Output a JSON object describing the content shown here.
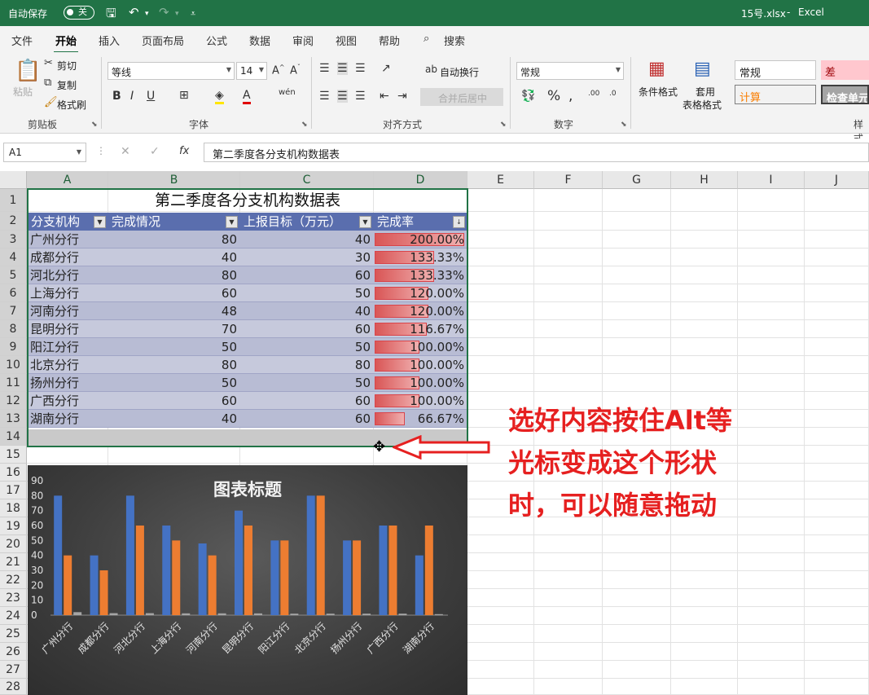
{
  "titlebar": {
    "autosave_label": "自动保存",
    "autosave_state": "关",
    "filename": "15号.xlsx",
    "separator": "-",
    "app": "Excel"
  },
  "ribbon_tabs": [
    "文件",
    "开始",
    "插入",
    "页面布局",
    "公式",
    "数据",
    "审阅",
    "视图",
    "帮助",
    "搜索"
  ],
  "ribbon": {
    "paste": "粘贴",
    "cut": "剪切",
    "copy": "复制",
    "format_painter": "格式刷",
    "clipboard_group": "剪贴板",
    "font_name": "等线",
    "font_size": "14",
    "font_group": "字体",
    "wrap_text": "自动换行",
    "merge_center": "合并后居中",
    "align_group": "对齐方式",
    "number_format": "常规",
    "number_group": "数字",
    "cond_format": "条件格式",
    "table_format_1": "套用",
    "table_format_2": "表格格式",
    "style_normal": "常规",
    "style_bad": "差",
    "style_calc": "计算",
    "style_check": "检查单元",
    "styles_group": "样式"
  },
  "formula_bar": {
    "name_box": "A1",
    "fx": "fx",
    "content": "第二季度各分支机构数据表"
  },
  "columns": [
    "A",
    "B",
    "C",
    "D",
    "E",
    "F",
    "G",
    "H",
    "I",
    "J"
  ],
  "rows": [
    "1",
    "2",
    "3",
    "4",
    "5",
    "6",
    "7",
    "8",
    "9",
    "10",
    "11",
    "12",
    "13",
    "14",
    "15",
    "16",
    "17",
    "18",
    "19",
    "20",
    "21",
    "22",
    "23",
    "24",
    "25",
    "26",
    "27",
    "28"
  ],
  "table": {
    "title": "第二季度各分支机构数据表",
    "headers": [
      "分支机构",
      "完成情况",
      "上报目标（万元）",
      "完成率"
    ],
    "rows": [
      {
        "name": "广州分行",
        "done": "80",
        "target": "40",
        "rate": "200.00%",
        "rate_value": 2.0
      },
      {
        "name": "成都分行",
        "done": "40",
        "target": "30",
        "rate": "133.33%",
        "rate_value": 1.3333
      },
      {
        "name": "河北分行",
        "done": "80",
        "target": "60",
        "rate": "133.33%",
        "rate_value": 1.3333
      },
      {
        "name": "上海分行",
        "done": "60",
        "target": "50",
        "rate": "120.00%",
        "rate_value": 1.2
      },
      {
        "name": "河南分行",
        "done": "48",
        "target": "40",
        "rate": "120.00%",
        "rate_value": 1.2
      },
      {
        "name": "昆明分行",
        "done": "70",
        "target": "60",
        "rate": "116.67%",
        "rate_value": 1.1667
      },
      {
        "name": "阳江分行",
        "done": "50",
        "target": "50",
        "rate": "100.00%",
        "rate_value": 1.0
      },
      {
        "name": "北京分行",
        "done": "80",
        "target": "80",
        "rate": "100.00%",
        "rate_value": 1.0
      },
      {
        "name": "扬州分行",
        "done": "50",
        "target": "50",
        "rate": "100.00%",
        "rate_value": 1.0
      },
      {
        "name": "广西分行",
        "done": "60",
        "target": "60",
        "rate": "100.00%",
        "rate_value": 1.0
      },
      {
        "name": "湖南分行",
        "done": "40",
        "target": "60",
        "rate": "66.67%",
        "rate_value": 0.6667
      }
    ]
  },
  "chart_data": {
    "type": "bar",
    "title": "图表标题",
    "categories": [
      "广州分行",
      "成都分行",
      "河北分行",
      "上海分行",
      "河南分行",
      "昆明分行",
      "阳江分行",
      "北京分行",
      "扬州分行",
      "广西分行",
      "湖南分行"
    ],
    "series": [
      {
        "values": [
          80,
          40,
          80,
          60,
          48,
          70,
          50,
          80,
          50,
          60,
          40
        ],
        "color": "#4472c4"
      },
      {
        "values": [
          40,
          30,
          60,
          50,
          40,
          60,
          50,
          80,
          50,
          60,
          60
        ],
        "color": "#ed7d31"
      },
      {
        "values": [
          2,
          1.33,
          1.33,
          1.2,
          1.2,
          1.17,
          1,
          1,
          1,
          1,
          0.67
        ],
        "color": "#a5a5a5"
      }
    ],
    "yticks": [
      "0",
      "10",
      "20",
      "30",
      "40",
      "50",
      "60",
      "70",
      "80",
      "90"
    ],
    "ylim": [
      0,
      90
    ],
    "grid": false
  },
  "annotation": {
    "line1": "选好内容按住Alt等",
    "line2": "光标变成这个形状",
    "line3": "时，可以随意拖动",
    "color": "#e62020"
  }
}
